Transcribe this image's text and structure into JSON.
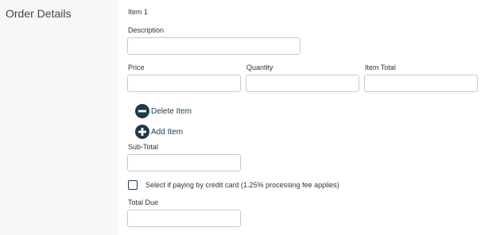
{
  "section": {
    "title": "Order Details"
  },
  "item": {
    "heading": "Item 1",
    "description": {
      "label": "Description",
      "value": ""
    },
    "price": {
      "label": "Price",
      "value": ""
    },
    "quantity": {
      "label": "Quantity",
      "value": ""
    },
    "item_total": {
      "label": "Item Total",
      "value": ""
    }
  },
  "actions": {
    "delete": {
      "label": "Delete Item",
      "icon": "minus-circle-icon"
    },
    "add": {
      "label": "Add Item",
      "icon": "plus-circle-icon"
    }
  },
  "subtotal": {
    "label": "Sub-Total",
    "value": ""
  },
  "credit_card": {
    "label": "Select if paying by credit card (1.25% processing fee applies)",
    "checked": false
  },
  "total_due": {
    "label": "Total Due",
    "value": ""
  },
  "colors": {
    "icon": "#1f3a4a",
    "sidebar": "#f7f7f7",
    "border": "#c9c9c9"
  }
}
